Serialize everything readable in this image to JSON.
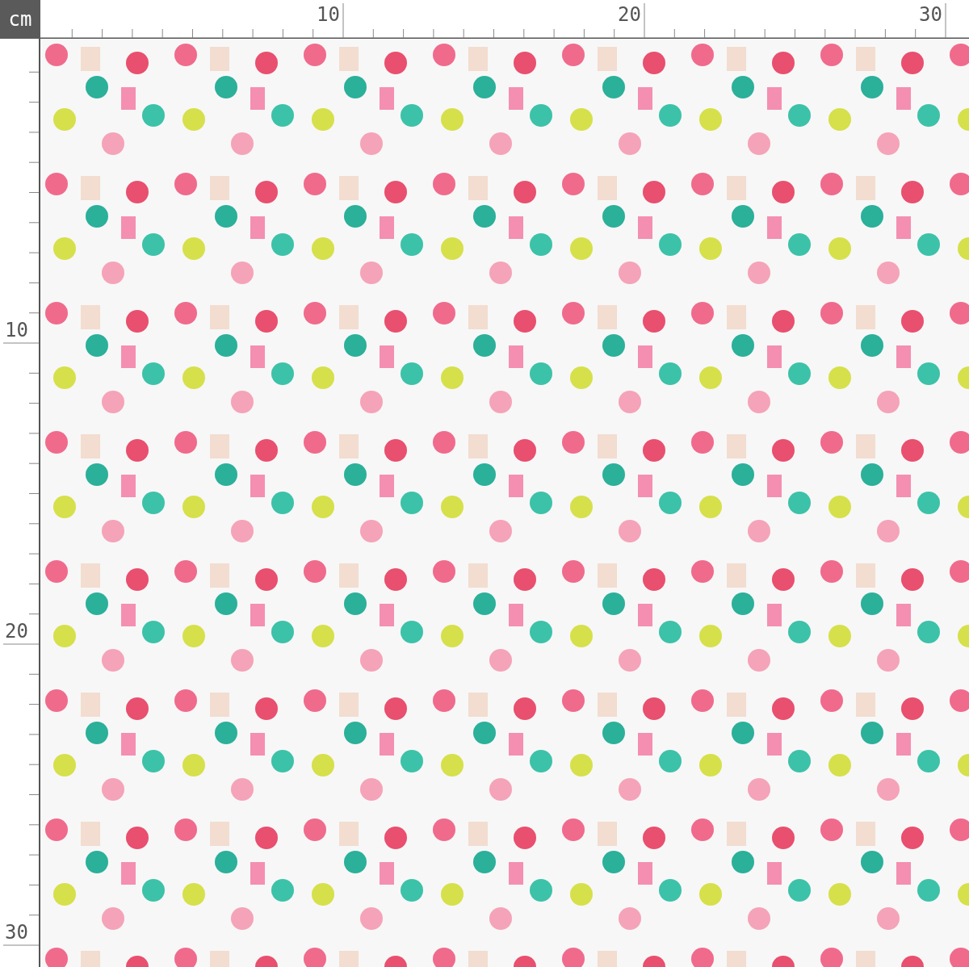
{
  "unit": "cm",
  "ruler_top": {
    "labels": [
      "10",
      "20",
      "30"
    ]
  },
  "ruler_left": {
    "labels": [
      "10",
      "20",
      "30"
    ]
  }
}
